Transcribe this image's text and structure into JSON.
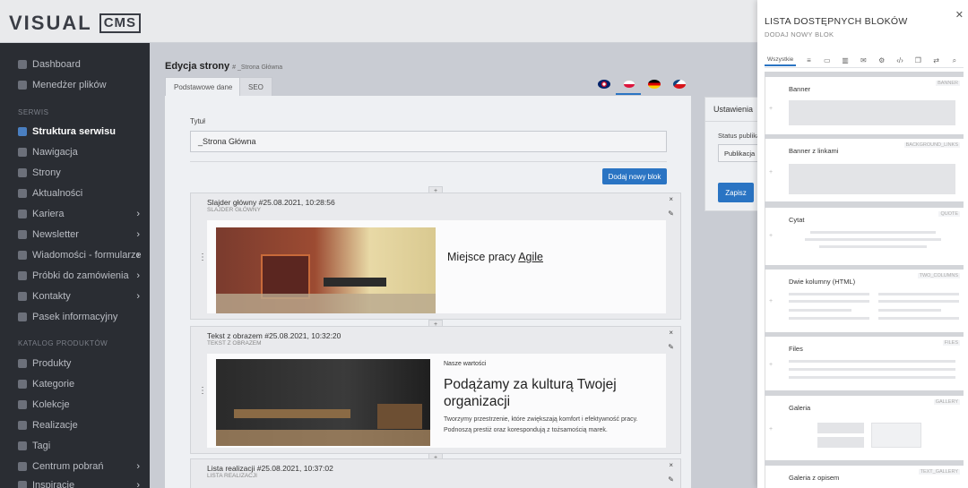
{
  "header": {
    "logo": "VISUAL",
    "logo_badge": "CMS"
  },
  "sidebar": {
    "items": [
      {
        "label": "Dashboard",
        "icon": "dashboard-icon"
      },
      {
        "label": "Menedżer plików",
        "icon": "file-manager-icon"
      },
      {
        "section": "SERWIS"
      },
      {
        "label": "Struktura serwisu",
        "icon": "sitemap-icon",
        "active": true
      },
      {
        "label": "Nawigacja",
        "icon": "navigation-icon"
      },
      {
        "label": "Strony",
        "icon": "pages-icon"
      },
      {
        "label": "Aktualności",
        "icon": "news-icon"
      },
      {
        "label": "Kariera",
        "icon": "career-icon",
        "chevron": "›"
      },
      {
        "label": "Newsletter",
        "icon": "newsletter-icon",
        "chevron": "›"
      },
      {
        "label": "Wiadomości - formularze",
        "icon": "messages-icon",
        "chevron": "›"
      },
      {
        "label": "Próbki do zamówienia",
        "icon": "samples-icon",
        "chevron": "›"
      },
      {
        "label": "Kontakty",
        "icon": "contacts-icon",
        "chevron": "›"
      },
      {
        "label": "Pasek informacyjny",
        "icon": "info-bar-icon"
      },
      {
        "section": "KATALOG PRODUKTÓW"
      },
      {
        "label": "Produkty",
        "icon": "products-icon"
      },
      {
        "label": "Kategorie",
        "icon": "categories-icon"
      },
      {
        "label": "Kolekcje",
        "icon": "collections-icon"
      },
      {
        "label": "Realizacje",
        "icon": "realizations-icon"
      },
      {
        "label": "Tagi",
        "icon": "tags-icon"
      },
      {
        "label": "Centrum pobrań",
        "icon": "downloads-icon",
        "chevron": "›"
      },
      {
        "label": "Inspiracje",
        "icon": "inspirations-icon",
        "chevron": "›"
      }
    ]
  },
  "main": {
    "title": "Edycja strony",
    "subtitle": "# _Strona Główna",
    "tabs": [
      "Podstawowe dane",
      "SEO"
    ],
    "field_label": "Tytuł",
    "field_value": "_Strona Główna",
    "add_block_button": "Dodaj nowy blok",
    "blocks": [
      {
        "title": "Slajder główny #25.08.2021, 10:28:56",
        "type": "SLAJDER GŁÓWNY",
        "heading": "Miejsce pracy",
        "heading_link": "Agile"
      },
      {
        "title": "Tekst z obrazem #25.08.2021, 10:32:20",
        "type": "TEKST Z OBRAZEM",
        "kicker": "Nasze wartości",
        "heading": "Podążamy za kulturą Twojej organizacji",
        "body": "Tworzymy przestrzenie, które zwiększają komfort i efektywność pracy. Podnoszą prestiż oraz korespondują z tożsamością marek."
      },
      {
        "title": "Lista realizacji #25.08.2021, 10:37:02",
        "type": "LISTA REALIZACJI"
      }
    ]
  },
  "settings": {
    "title": "Ustawienia",
    "status_label": "Status publikacji",
    "status_value": "Publikacja",
    "save_button": "Zapisz"
  },
  "drawer": {
    "title": "LISTA DOSTĘPNYCH BLOKÓW",
    "subtitle": "DODAJ NOWY BLOK",
    "filter_all": "Wszystkie",
    "blocks": [
      {
        "name": "Banner",
        "code": "BANNER"
      },
      {
        "name": "Banner z linkami",
        "code": "BACKGROUND_LINKS"
      },
      {
        "name": "Cytat",
        "code": "QUOTE"
      },
      {
        "name": "Dwie kolumny (HTML)",
        "code": "TWO_COLUMNS"
      },
      {
        "name": "Files",
        "code": "FILES"
      },
      {
        "name": "Galeria",
        "code": "GALLERY"
      },
      {
        "name": "Galeria z opisem",
        "code": "TEXT_GALLERY"
      }
    ]
  },
  "colors": {
    "accent": "#2a74c3",
    "sidebar": "#2a2d33"
  }
}
